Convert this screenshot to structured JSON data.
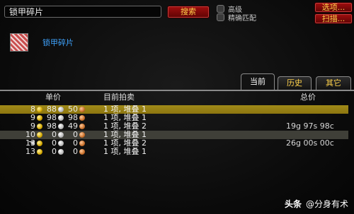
{
  "search": {
    "query": "锁甲碎片"
  },
  "buttons": {
    "search": "搜索",
    "options": "选项...",
    "scan": "扫描..."
  },
  "checks": {
    "advanced": "高级",
    "exact": "精确匹配"
  },
  "item": {
    "name": "锁甲碎片"
  },
  "tabs": {
    "current": "当前",
    "history": "历史",
    "other": "其它"
  },
  "columns": {
    "unit_price": "单价",
    "current_auctions": "目前拍卖",
    "total_price": "总价"
  },
  "rows": [
    {
      "gold": "8",
      "silver": "88",
      "copper": "50",
      "auction": "1 项, 堆叠 1",
      "total": ""
    },
    {
      "gold": "9",
      "silver": "98",
      "copper": "98",
      "auction": "1 项, 堆叠 1",
      "total": ""
    },
    {
      "gold": "9",
      "silver": "98",
      "copper": "49",
      "auction": "1 项, 堆叠 2",
      "total": "19g 97s 98c"
    },
    {
      "gold": "10",
      "silver": "0",
      "copper": "0",
      "auction": "1 项, 堆叠 1",
      "total": ""
    },
    {
      "gold": "13",
      "silver": "0",
      "copper": "0",
      "auction": "1 项, 堆叠 2",
      "total": "26g 00s 00c"
    },
    {
      "gold": "13",
      "silver": "0",
      "copper": "0",
      "auction": "1 项, 堆叠 1",
      "total": ""
    }
  ],
  "watermark": {
    "brand": "头条",
    "account": "@分身有术"
  },
  "icons": {
    "item": "chain-mail-fragment-icon",
    "cursor": "hand-cursor-icon"
  }
}
